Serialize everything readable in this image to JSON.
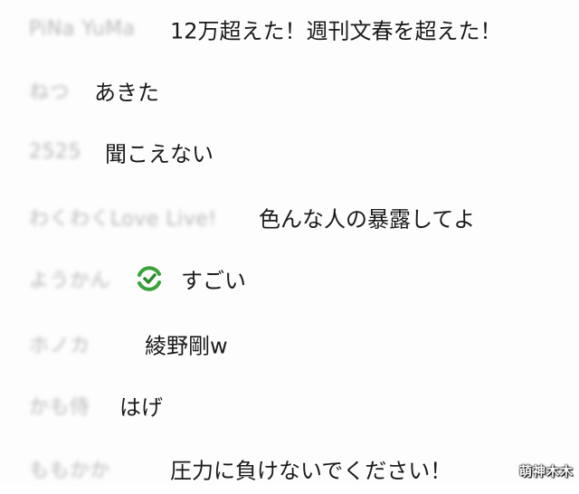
{
  "messages": [
    {
      "user": "PiNa YuMa",
      "text": "12万超えた！週刊文春を超えた！"
    },
    {
      "user": "ねつ",
      "text": "あきた"
    },
    {
      "user": "2525",
      "text": "聞こえない"
    },
    {
      "user": "わくわくLove Live!",
      "text": "色んな人の暴露してよ"
    },
    {
      "user": "ようかん",
      "text": "すごい",
      "icon": "green-emote-icon"
    },
    {
      "user": "ホノカ",
      "text": "綾野剛w"
    },
    {
      "user": "かも侍",
      "text": "はげ"
    },
    {
      "user": "ももかか",
      "text": "圧力に負けないでください！"
    }
  ],
  "watermark": "萌神木木",
  "colors": {
    "emote_green": "#3aa33a",
    "text": "#1a1a1a",
    "blurred_name": "#b9b9b9"
  }
}
